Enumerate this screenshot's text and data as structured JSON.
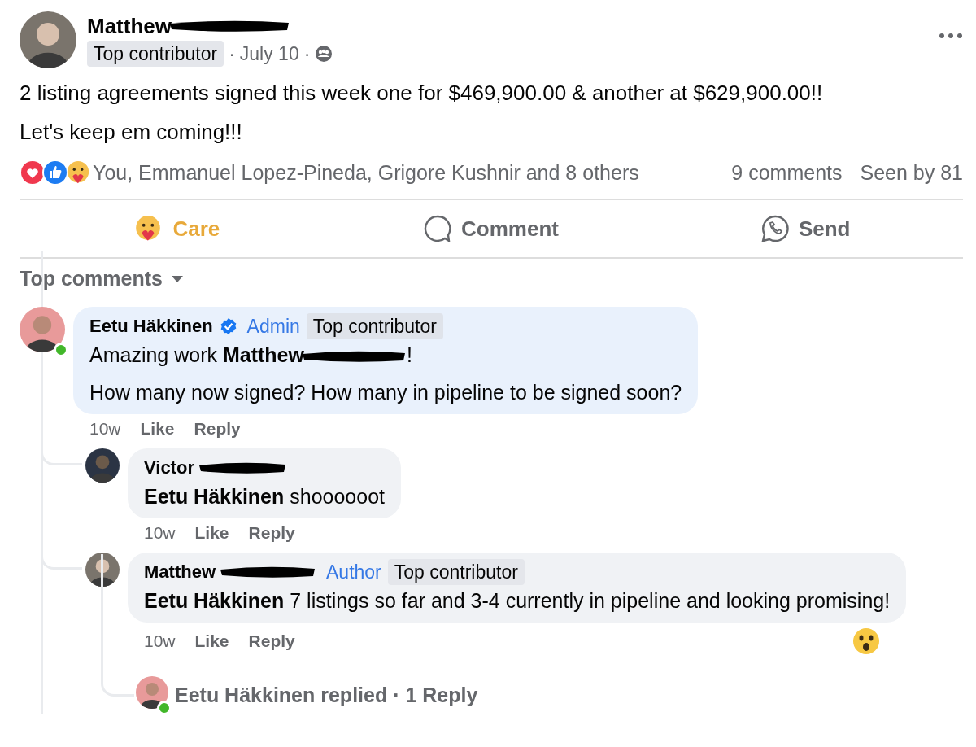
{
  "post": {
    "author": {
      "name": "Matthew",
      "redacted": true,
      "badge": "Top contributor",
      "date": "July 10",
      "separator": "·"
    },
    "paragraphs": [
      "2 listing agreements signed this week one for $469,900.00 & another at $629,900.00!!",
      "Let's keep em coming!!!"
    ],
    "reactions": {
      "summary": "You, Emmanuel Lopez-Pineda, Grigore Kushnir and 8 others",
      "comments": "9 comments",
      "seen": "Seen by 81"
    },
    "actions": [
      {
        "kind": "care",
        "label": "Care",
        "selected": true
      },
      {
        "kind": "comment",
        "label": "Comment",
        "selected": false
      },
      {
        "kind": "send",
        "label": "Send",
        "selected": false
      }
    ]
  },
  "comments_section": {
    "sort_label": "Top comments",
    "comments": [
      {
        "name": "Eetu Häkkinen",
        "verified": true,
        "online": true,
        "badges": [
          {
            "kind": "role",
            "label": "Admin"
          },
          {
            "kind": "contributor",
            "label": "Top contributor"
          }
        ],
        "paragraphs": [
          [
            {
              "kind": "text",
              "text": "Amazing work "
            },
            {
              "kind": "bold",
              "text": "Matthew"
            },
            {
              "kind": "redaction"
            },
            {
              "kind": "text",
              "text": "!"
            }
          ],
          [
            {
              "kind": "text",
              "text": "How many now signed? How many in pipeline to be signed soon?"
            }
          ]
        ],
        "meta": [
          "10w",
          "Like",
          "Reply"
        ],
        "children": [
          {
            "name": "Victor",
            "redacted": true,
            "paragraphs": [
              [
                {
                  "kind": "bold",
                  "text": "Eetu Häkkinen"
                },
                {
                  "kind": "text",
                  "text": " shoooooot"
                }
              ]
            ],
            "meta": [
              "10w",
              "Like",
              "Reply"
            ]
          },
          {
            "name": "Matthew",
            "redacted": true,
            "badges": [
              {
                "kind": "role",
                "label": "Author"
              },
              {
                "kind": "contributor",
                "label": "Top contributor"
              }
            ],
            "paragraphs": [
              [
                {
                  "kind": "bold",
                  "text": "Eetu Häkkinen"
                },
                {
                  "kind": "text",
                  "text": " 7 listings so far and 3-4 currently in pipeline and looking promising!"
                }
              ]
            ],
            "meta": [
              "10w",
              "Like",
              "Reply"
            ],
            "wow_reacted": true,
            "replies": {
              "text": "Eetu Häkkinen replied · 1 Reply",
              "online": true
            }
          }
        ]
      }
    ]
  }
}
